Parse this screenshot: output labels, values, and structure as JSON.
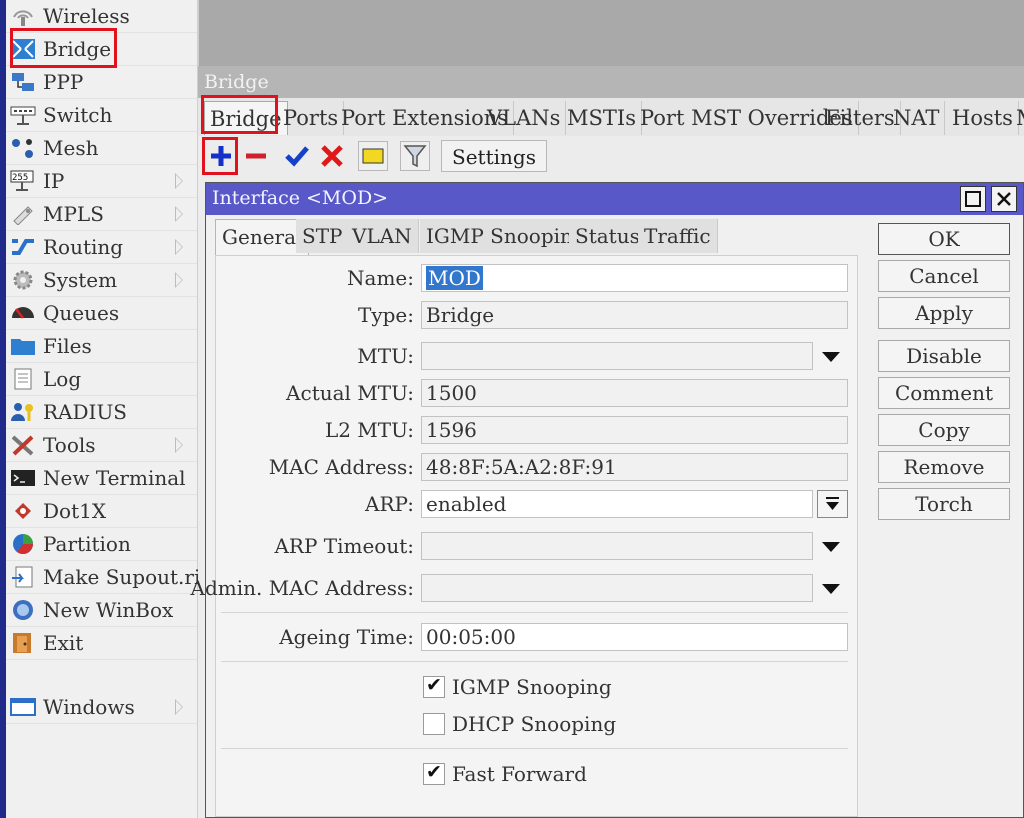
{
  "menu": {
    "items": [
      {
        "label": "Wireless",
        "icon": "wireless-icon",
        "submenu": false
      },
      {
        "label": "Bridge",
        "icon": "bridge-icon",
        "submenu": false
      },
      {
        "label": "PPP",
        "icon": "ppp-icon",
        "submenu": false
      },
      {
        "label": "Switch",
        "icon": "switch-icon",
        "submenu": false
      },
      {
        "label": "Mesh",
        "icon": "mesh-icon",
        "submenu": false
      },
      {
        "label": "IP",
        "icon": "ip-icon",
        "submenu": true
      },
      {
        "label": "MPLS",
        "icon": "mpls-icon",
        "submenu": true
      },
      {
        "label": "Routing",
        "icon": "routing-icon",
        "submenu": true
      },
      {
        "label": "System",
        "icon": "system-gear-icon",
        "submenu": true
      },
      {
        "label": "Queues",
        "icon": "queues-icon",
        "submenu": false
      },
      {
        "label": "Files",
        "icon": "folder-icon",
        "submenu": false
      },
      {
        "label": "Log",
        "icon": "log-icon",
        "submenu": false
      },
      {
        "label": "RADIUS",
        "icon": "radius-icon",
        "submenu": false
      },
      {
        "label": "Tools",
        "icon": "tools-icon",
        "submenu": true
      },
      {
        "label": "New Terminal",
        "icon": "terminal-icon",
        "submenu": false
      },
      {
        "label": "Dot1X",
        "icon": "dot1x-icon",
        "submenu": false
      },
      {
        "label": "Partition",
        "icon": "partition-icon",
        "submenu": false
      },
      {
        "label": "Make Supout.rif",
        "icon": "supout-icon",
        "submenu": false
      },
      {
        "label": "New WinBox",
        "icon": "winbox-icon",
        "submenu": false
      },
      {
        "label": "Exit",
        "icon": "exit-icon",
        "submenu": false
      }
    ],
    "windows": {
      "label": "Windows",
      "icon": "windows-icon",
      "submenu": true
    }
  },
  "bridge_window": {
    "title": "Bridge",
    "tabs": [
      "Bridge",
      "Ports",
      "Port Extensions",
      "VLANs",
      "MSTIs",
      "Port MST Overrides",
      "Filters",
      "NAT",
      "Hosts",
      "M"
    ],
    "active_tab": "Bridge",
    "toolbar": {
      "settings_label": "Settings",
      "icons": [
        "add-icon",
        "remove-icon",
        "enable-check-icon",
        "disable-x-icon",
        "comment-note-icon",
        "filter-icon"
      ]
    }
  },
  "dialog": {
    "title": "Interface <MOD>",
    "tabs": [
      "General",
      "STP",
      "VLAN",
      "IGMP Snooping",
      "Status",
      "Traffic"
    ],
    "active_tab": "General",
    "fields": {
      "name": {
        "label": "Name:",
        "value": "MOD"
      },
      "type": {
        "label": "Type:",
        "value": "Bridge"
      },
      "mtu": {
        "label": "MTU:",
        "value": ""
      },
      "actual_mtu": {
        "label": "Actual MTU:",
        "value": "1500"
      },
      "l2_mtu": {
        "label": "L2 MTU:",
        "value": "1596"
      },
      "mac_address": {
        "label": "MAC Address:",
        "value": "48:8F:5A:A2:8F:91"
      },
      "arp": {
        "label": "ARP:",
        "value": "enabled"
      },
      "arp_timeout": {
        "label": "ARP Timeout:",
        "value": ""
      },
      "admin_mac": {
        "label": "Admin. MAC Address:",
        "value": ""
      },
      "ageing_time": {
        "label": "Ageing Time:",
        "value": "00:05:00"
      }
    },
    "checkboxes": [
      {
        "label": "IGMP Snooping",
        "checked": true
      },
      {
        "label": "DHCP Snooping",
        "checked": false
      },
      {
        "label": "Fast Forward",
        "checked": true
      }
    ],
    "buttons": {
      "ok": "OK",
      "cancel": "Cancel",
      "apply": "Apply",
      "disable": "Disable",
      "comment": "Comment",
      "copy": "Copy",
      "remove": "Remove",
      "torch": "Torch"
    }
  },
  "colors": {
    "highlight_red": "#e0121e",
    "dialog_title_bar": "#5858c8",
    "selection_blue": "#3377cc",
    "add_blue": "#1530c8"
  }
}
